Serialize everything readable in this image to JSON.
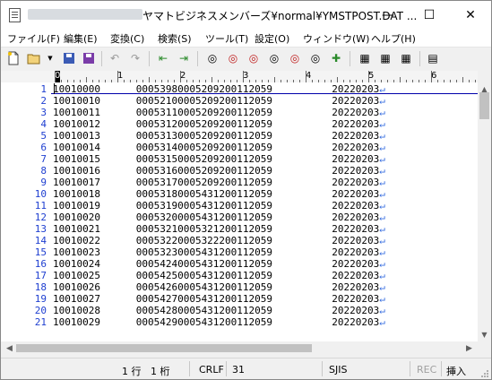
{
  "window": {
    "title": "ヤマトビジネスメンバーズ¥normal¥YMSTPOST.DAT ...",
    "minimize_glyph": "—",
    "maximize_glyph": "☐",
    "close_glyph": "✕"
  },
  "menu": [
    "ファイル(F)",
    "編集(E)",
    "変換(C)",
    "検索(S)",
    "ツール(T)",
    "設定(O)",
    "ウィンドウ(W)",
    "ヘルプ(H)"
  ],
  "toolbar_icons": [
    "new-file-icon",
    "open-folder-icon",
    "save-icon",
    "save-all-icon",
    "undo-icon",
    "redo-icon",
    "jump-back-icon",
    "jump-forward-icon",
    "search-icon",
    "search-next-icon",
    "search-prev-icon",
    "search-highlight-icon",
    "bookmark-icon",
    "bookmark-next-icon",
    "grep-icon",
    "compare-icon",
    "outline-icon",
    "settings-icon"
  ],
  "ruler": {
    "cursor_label": "0",
    "labels": [
      "1",
      "2",
      "3",
      "4",
      "5",
      "6"
    ]
  },
  "editor": {
    "eol_mark": "↵",
    "lines": [
      {
        "no": "1",
        "text": "10010000      00053980005209200112059          20220203"
      },
      {
        "no": "2",
        "text": "10010010      00052100005209200112059          20220203"
      },
      {
        "no": "3",
        "text": "10010011      00053110005209200112059          20220203"
      },
      {
        "no": "4",
        "text": "10010012      00053120005209200112059          20220203"
      },
      {
        "no": "5",
        "text": "10010013      00053130005209200112059          20220203"
      },
      {
        "no": "6",
        "text": "10010014      00053140005209200112059          20220203"
      },
      {
        "no": "7",
        "text": "10010015      00053150005209200112059          20220203"
      },
      {
        "no": "8",
        "text": "10010016      00053160005209200112059          20220203"
      },
      {
        "no": "9",
        "text": "10010017      00053170005209200112059          20220203"
      },
      {
        "no": "10",
        "text": "10010018      00053180005431200112059          20220203"
      },
      {
        "no": "11",
        "text": "10010019      00053190005431200112059          20220203"
      },
      {
        "no": "12",
        "text": "10010020      00053200005431200112059          20220203"
      },
      {
        "no": "13",
        "text": "10010021      00053210005321200112059          20220203"
      },
      {
        "no": "14",
        "text": "10010022      00053220005322200112059          20220203"
      },
      {
        "no": "15",
        "text": "10010023      00053230005431200112059          20220203"
      },
      {
        "no": "16",
        "text": "10010024      00054240005431200112059          20220203"
      },
      {
        "no": "17",
        "text": "10010025      00054250005431200112059          20220203"
      },
      {
        "no": "18",
        "text": "10010026      00054260005431200112059          20220203"
      },
      {
        "no": "19",
        "text": "10010027      00054270005431200112059          20220203"
      },
      {
        "no": "20",
        "text": "10010028      00054280005431200112059          20220203"
      },
      {
        "no": "21",
        "text": "10010029      00054290005431200112059          20220203"
      }
    ]
  },
  "status": {
    "row": "1 行",
    "col": "1 桁",
    "eol": "CRLF",
    "code": "31",
    "encoding": "SJIS",
    "rec": "REC",
    "insert": "挿入"
  }
}
